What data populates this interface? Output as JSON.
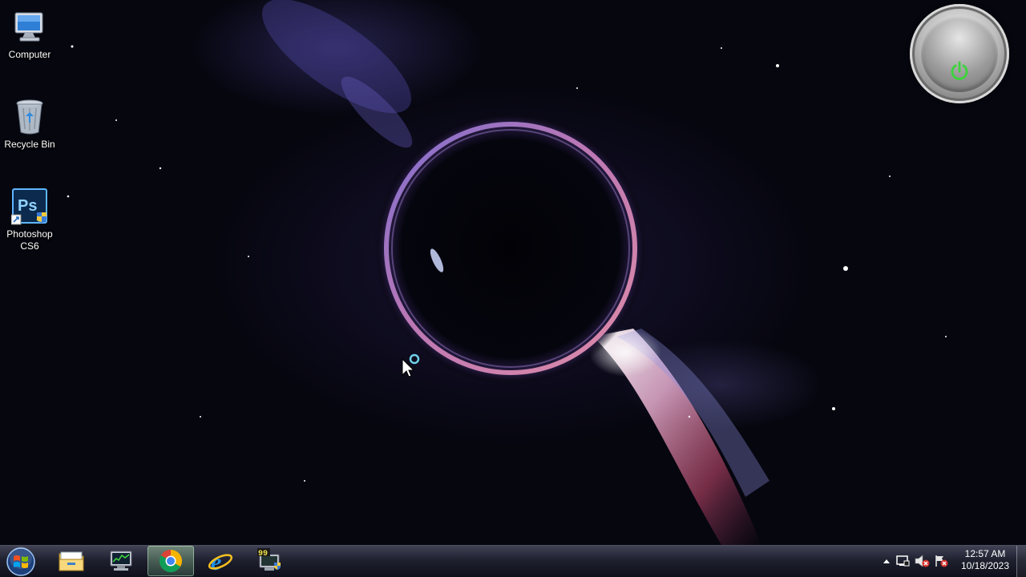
{
  "desktop": {
    "icons": [
      {
        "label": "Computer"
      },
      {
        "label": "Recycle Bin"
      },
      {
        "label": "Photoshop\nCS6",
        "badge": "Ps"
      }
    ]
  },
  "gadget": {
    "icon": "power-icon",
    "accent": "#3fd23f"
  },
  "taskbar": {
    "start": {
      "icon": "windows-start-orb-icon"
    },
    "pinned": [
      {
        "name": "windows-explorer",
        "icon": "folder-icon"
      },
      {
        "name": "task-manager",
        "icon": "monitor-chart-icon"
      },
      {
        "name": "google-chrome",
        "icon": "chrome-icon",
        "active": true
      },
      {
        "name": "internet-explorer",
        "icon": "ie-icon"
      },
      {
        "name": "app-99",
        "icon": "monitor-shield-icon",
        "badge": "99"
      }
    ],
    "tray": {
      "icons": [
        "show-hidden-icons-arrow",
        "action-center-icon",
        "volume-muted-icon",
        "network-disconnected-icon"
      ]
    },
    "clock": {
      "time": "12:57 AM",
      "date": "10/18/2023"
    }
  }
}
